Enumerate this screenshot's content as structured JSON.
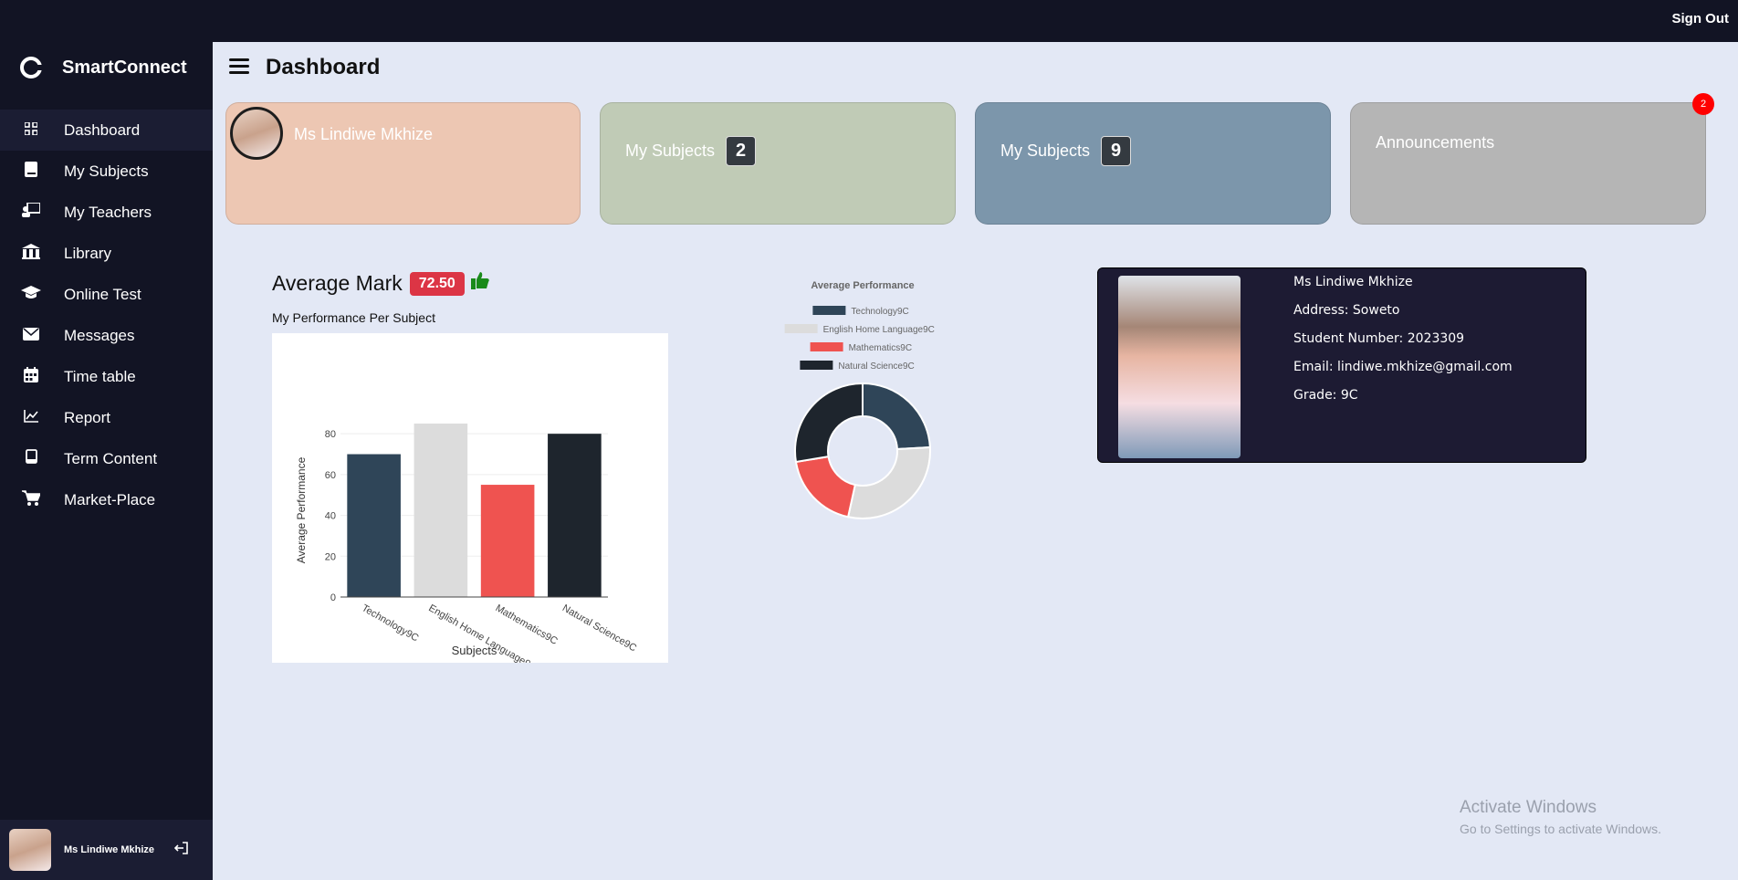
{
  "app": {
    "name": "SmartConnect",
    "sign_out": "Sign Out"
  },
  "sidebar": {
    "items": [
      {
        "label": "Dashboard",
        "icon": "grid-icon",
        "active": true
      },
      {
        "label": "My Subjects",
        "icon": "book-icon"
      },
      {
        "label": "My Teachers",
        "icon": "teacher-icon"
      },
      {
        "label": "Library",
        "icon": "library-icon"
      },
      {
        "label": "Online Test",
        "icon": "graduation-cap-icon"
      },
      {
        "label": "Messages",
        "icon": "envelope-icon"
      },
      {
        "label": "Time table",
        "icon": "calendar-icon"
      },
      {
        "label": "Report",
        "icon": "line-chart-icon"
      },
      {
        "label": "Term Content",
        "icon": "tablet-icon"
      },
      {
        "label": "Market-Place",
        "icon": "cart-icon"
      }
    ],
    "user": {
      "name": "Ms Lindiwe Mkhize"
    }
  },
  "header": {
    "title": "Dashboard"
  },
  "cards": {
    "profile": {
      "name": "Ms Lindiwe Mkhize",
      "color": "#edc7b3"
    },
    "subjects1": {
      "label": "My Subjects",
      "count": "2",
      "color": "#c0cbb6"
    },
    "subjects2": {
      "label": "My Subjects",
      "count": "9",
      "color": "#7c96ab"
    },
    "announcements": {
      "label": "Announcements",
      "badge": "2",
      "color": "#b5b5b5"
    }
  },
  "average": {
    "title": "Average Mark",
    "value": "72.50",
    "subtitle": "My Performance Per Subject"
  },
  "student": {
    "name": "Ms Lindiwe Mkhize",
    "address": "Address: Soweto",
    "student_number": "Student Number: 2023309",
    "email": "Email: lindiwe.mkhize@gmail.com",
    "grade": "Grade: 9C"
  },
  "watermark": {
    "line1": "Activate Windows",
    "line2": "Go to Settings to activate Windows."
  },
  "chart_data": [
    {
      "type": "bar",
      "categories": [
        "Technology9C",
        "English Home Language9C",
        "Mathematics9C",
        "Natural Science9C"
      ],
      "values": [
        70,
        85,
        55,
        80
      ],
      "colors": [
        "#2f4558",
        "#dcdcdc",
        "#ef5350",
        "#1e252d"
      ],
      "xlabel": "Subjects",
      "ylabel": "Average Performance",
      "yticks": [
        0,
        20,
        40,
        60,
        80
      ],
      "ylim": [
        0,
        85
      ]
    },
    {
      "type": "pie",
      "title": "Average Performance",
      "labels": [
        "Technology9C",
        "English Home Language9C",
        "Mathematics9C",
        "Natural Science9C"
      ],
      "values": [
        70,
        85,
        55,
        80
      ],
      "colors": [
        "#2f4558",
        "#dcdcdc",
        "#ef5350",
        "#1e252d"
      ],
      "legend": "top"
    }
  ]
}
